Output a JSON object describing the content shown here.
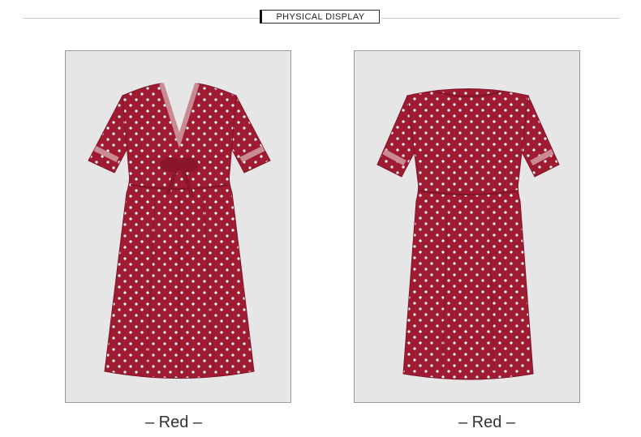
{
  "section_title": "PHYSICAL DISPLAY",
  "images": [
    {
      "view": "front",
      "caption": "– Red –"
    },
    {
      "view": "back",
      "caption": "– Red –"
    }
  ],
  "colors": {
    "dress": "#9e1b32",
    "dress_shadow": "#7f1426",
    "dot": "#ffffff",
    "panel_bg": "#e6e6e6",
    "lace": "#c98a92"
  }
}
